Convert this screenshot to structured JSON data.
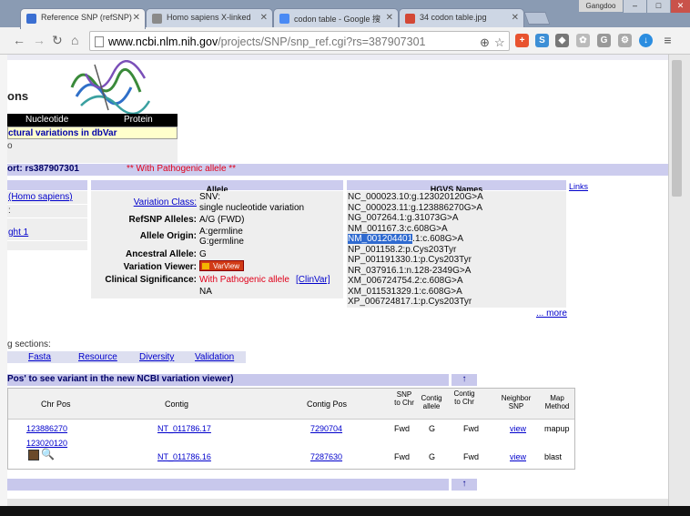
{
  "browser": {
    "tabs": [
      {
        "label": "Reference SNP (refSNP)",
        "active": true,
        "favicon_color": "#3b6fd2"
      },
      {
        "label": "Homo sapiens X-linked",
        "active": false,
        "favicon_color": "#8a8a8a"
      },
      {
        "label": "codon table - Google 搜",
        "active": false,
        "favicon_color": "#4a8af4"
      },
      {
        "label": "34 codon table.jpg",
        "active": false,
        "favicon_color": "#d34836"
      }
    ],
    "user_badge": "Gangdoo",
    "url_host": "www.ncbi.nlm.nih.gov",
    "url_path": "/projects/SNP/snp_ref.cgi?rs=387907301"
  },
  "page": {
    "heading_frag": "ons",
    "tab_nucleotide": "Nucleotide",
    "tab_protein": "Protein",
    "structural_link": "ctural variations in dbVar",
    "gray_fragment": "o",
    "report_title": "ort: rs387907301",
    "pathogenic_banner": "** With Pathogenic allele **",
    "left_links": [
      "(Homo sapiens)",
      ":",
      "ght 1"
    ],
    "allele_header": "Allele",
    "variation_class_label": "Variation Class:",
    "variation_class_value1": "SNV:",
    "variation_class_value2": "single nucleotide variation",
    "refsnp_alleles_label": "RefSNP Alleles:",
    "refsnp_alleles_value": "A/G (FWD)",
    "allele_origin_label": "Allele Origin:",
    "allele_origin_value1": "A:germline",
    "allele_origin_value2": "G:germline",
    "ancestral_allele_label": "Ancestral Allele:",
    "ancestral_allele_value": "G",
    "variation_viewer_label": "Variation Viewer:",
    "varview_button": "VarView",
    "clinical_label": "Clinical Significance:",
    "clinical_value": "With Pathogenic allele",
    "clinvar_link": "[ClinVar]",
    "clinical_na": "NA",
    "hgvs_header": "HGVS Names",
    "links_label": "Links",
    "hgvs_names": [
      {
        "pre": "NC_000023.10:g.123020120G>A",
        "hl": "",
        "post": ""
      },
      {
        "pre": "NC_000023.11:g.123886270G>A",
        "hl": "",
        "post": ""
      },
      {
        "pre": "NG_007264.1:g.31073G>A",
        "hl": "",
        "post": ""
      },
      {
        "pre": "NM_001167.3:c.608G>A",
        "hl": "",
        "post": ""
      },
      {
        "pre": "",
        "hl": "NM_001204401",
        "post": ".1:c.608G>A"
      },
      {
        "pre": "NP_001158.2:p.Cys203Tyr",
        "hl": "",
        "post": ""
      },
      {
        "pre": "NP_001191330.1:p.Cys203Tyr",
        "hl": "",
        "post": ""
      },
      {
        "pre": "NR_037916.1:n.128-2349G>A",
        "hl": "",
        "post": ""
      },
      {
        "pre": "XM_006724754.2:c.608G>A",
        "hl": "",
        "post": ""
      },
      {
        "pre": "XM_011531329.1:c.608G>A",
        "hl": "",
        "post": ""
      },
      {
        "pre": "XP_006724817.1:p.Cys203Tyr",
        "hl": "",
        "post": ""
      }
    ],
    "more_link": "... more",
    "sections_label": "g sections:",
    "section_links": [
      "Fasta",
      "Resource",
      "Diversity",
      "Validation"
    ],
    "viewer_note": "Pos' to see variant in the new NCBI variation viewer)",
    "up_arrow": "↑",
    "table_headers": [
      "Chr Pos",
      "Contig",
      "Contig Pos",
      "SNP to Chr",
      "Contig allele",
      "Contig to Chr",
      "Neighbor SNP",
      "Map Method"
    ],
    "table_rows": [
      {
        "chr_pos": "123886270",
        "contig": "NT_011786.17",
        "contig_pos": "7290704",
        "snp_to_chr": "Fwd",
        "contig_allele": "G",
        "contig_to_chr": "Fwd",
        "neighbor": "view",
        "map_method": "mapup"
      },
      {
        "chr_pos": "123020120",
        "contig": "NT_011786.16",
        "contig_pos": "7287630",
        "snp_to_chr": "Fwd",
        "contig_allele": "G",
        "contig_to_chr": "Fwd",
        "neighbor": "view",
        "map_method": "blast"
      }
    ]
  }
}
